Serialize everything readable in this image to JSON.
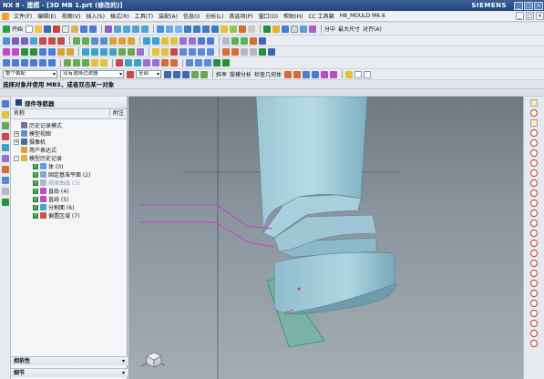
{
  "window": {
    "title": "NX 8 - 建模 - [3D MB 1.prt (修改的)]",
    "brand": "SIEMENS",
    "controls": [
      "_",
      "□",
      "×"
    ]
  },
  "menubar": {
    "items": [
      "文件(F)",
      "编辑(E)",
      "视图(V)",
      "插入(S)",
      "格式(R)",
      "工具(T)",
      "装配(A)",
      "信息(I)",
      "分析(L)",
      "首选项(P)",
      "窗口(O)",
      "帮助(H)",
      "CC 工具箱",
      "H8_MOULD M6.6"
    ],
    "window_controls": [
      "_",
      "□",
      "×"
    ]
  },
  "toolbar1": {
    "start_label": "开始",
    "right_labels": [
      "分中",
      "最大尺寸",
      "对齐(A)"
    ]
  },
  "toolbar5": {
    "filter_type": "整个装配",
    "selection_filter": "没有选择过滤器",
    "scope": "全部",
    "labels": [
      "斜率",
      "拔模分析",
      "检查几何体"
    ]
  },
  "status": {
    "prompt": "选择对象并使用 MB3，或者双击某一对象"
  },
  "navigator": {
    "title": "部件导航器",
    "columns": {
      "name": "名称",
      "sort": "附注"
    },
    "tree": [
      {
        "label": "历史记录模式",
        "level": 0,
        "expander": "",
        "check": false,
        "icon": "history-mode-icon",
        "color": "#7b6cae",
        "gray": false
      },
      {
        "label": "模型视图",
        "level": 0,
        "expander": "+",
        "check": false,
        "icon": "model-views-icon",
        "color": "#5e8fc8",
        "gray": false
      },
      {
        "label": "摄像机",
        "level": 0,
        "expander": "+",
        "check": false,
        "icon": "camera-icon",
        "color": "#4a6a9c",
        "gray": false
      },
      {
        "label": "用户表达式",
        "level": 0,
        "expander": "",
        "check": false,
        "icon": "expression-icon",
        "color": "#d6a13b",
        "gray": false
      },
      {
        "label": "模型历史记录",
        "level": 0,
        "expander": "-",
        "check": false,
        "icon": "model-history-icon",
        "color": "#e0b24a",
        "gray": false
      },
      {
        "label": "体 (0)",
        "level": 1,
        "expander": "",
        "check": true,
        "icon": "body-icon",
        "color": "#5fa0d8",
        "gray": false
      },
      {
        "label": "固定基准平面 (2)",
        "level": 1,
        "expander": "",
        "check": true,
        "icon": "datum-plane-icon",
        "color": "#8aa5c7",
        "gray": false
      },
      {
        "label": "规律曲线 (3)",
        "level": 1,
        "expander": "",
        "check": true,
        "icon": "law-curve-icon",
        "color": "#b0b6c0",
        "gray": true
      },
      {
        "label": "直线 (4)",
        "level": 1,
        "expander": "",
        "check": true,
        "icon": "line-icon",
        "color": "#c04ac8",
        "gray": false
      },
      {
        "label": "直线 (5)",
        "level": 1,
        "expander": "",
        "check": true,
        "icon": "line-icon",
        "color": "#c04ac8",
        "gray": false
      },
      {
        "label": "分割面 (6)",
        "level": 1,
        "expander": "",
        "check": true,
        "icon": "divide-face-icon",
        "color": "#4aa0d0",
        "gray": false
      },
      {
        "label": "偏置区域 (7)",
        "level": 1,
        "expander": "",
        "check": true,
        "icon": "offset-region-icon",
        "color": "#d05050",
        "gray": false
      }
    ],
    "sections": [
      "相依性",
      "细节"
    ]
  }
}
